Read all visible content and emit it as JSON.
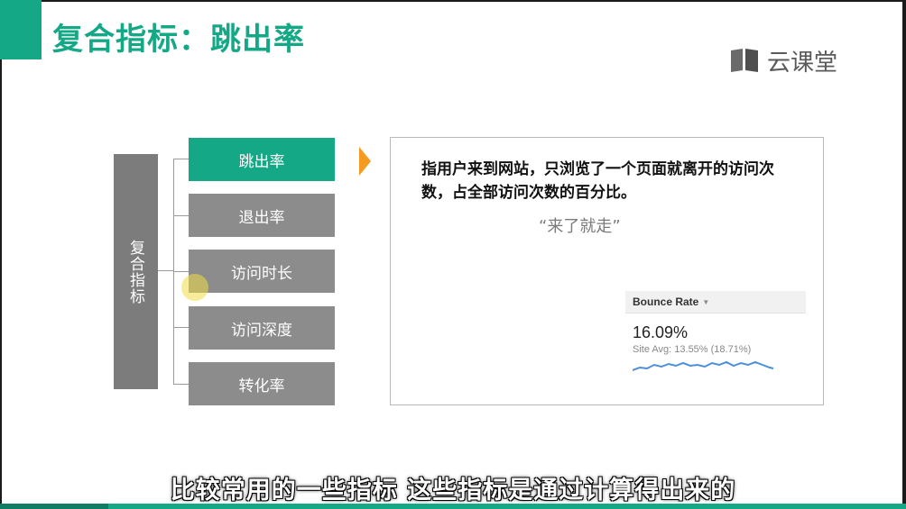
{
  "slide": {
    "title": "复合指标：跳出率",
    "logo_text": "云课堂",
    "accent_color": "#15a886",
    "pointer_color": "#f39a1f",
    "logo_icon": "book-icon"
  },
  "tree": {
    "root_label": "复合指标",
    "items": [
      {
        "label": "跳出率",
        "active": true
      },
      {
        "label": "退出率",
        "active": false
      },
      {
        "label": "访问时长",
        "active": false
      },
      {
        "label": "访问深度",
        "active": false
      },
      {
        "label": "转化率",
        "active": false
      }
    ]
  },
  "panel": {
    "definition": "指用户来到网站，只浏览了一个页面就离开的访问次数，占全部访问次数的百分比。",
    "quote": "“来了就走”",
    "widget": {
      "header": "Bounce Rate",
      "value": "16.09%",
      "site_avg": "Site Avg: 13.55% (18.71%)",
      "line_color": "#4a8fd9"
    }
  },
  "subtitle": "比较常用的一些指标  这些指标是通过计算得出来的"
}
